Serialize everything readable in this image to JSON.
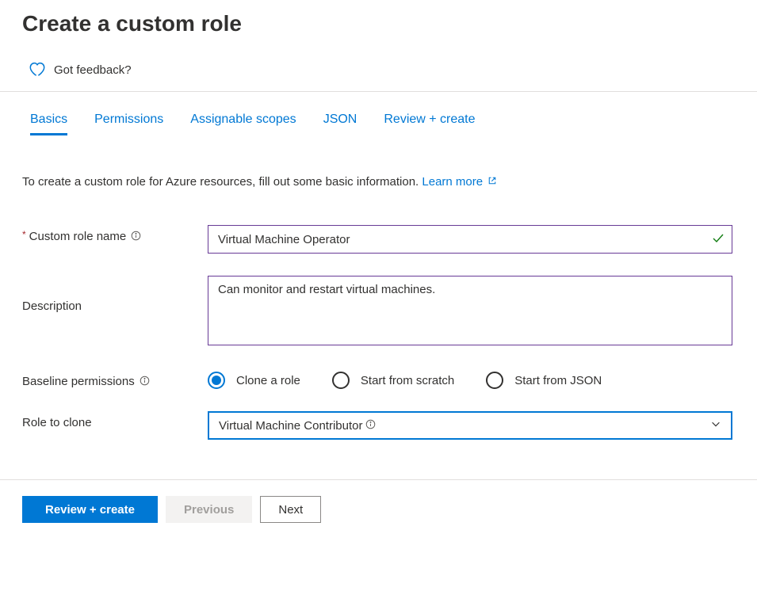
{
  "page_title": "Create a custom role",
  "feedback_label": "Got feedback?",
  "tabs": {
    "basics": "Basics",
    "permissions": "Permissions",
    "scopes": "Assignable scopes",
    "json": "JSON",
    "review": "Review + create"
  },
  "intro": {
    "text": "To create a custom role for Azure resources, fill out some basic information. ",
    "learn_more": "Learn more"
  },
  "form": {
    "name_label": "Custom role name",
    "name_value": "Virtual Machine Operator",
    "desc_label": "Description",
    "desc_value": "Can monitor and restart virtual machines.",
    "baseline_label": "Baseline permissions",
    "baseline_options": {
      "clone": "Clone a role",
      "scratch": "Start from scratch",
      "json": "Start from JSON"
    },
    "clone_label": "Role to clone",
    "clone_value": "Virtual Machine Contributor"
  },
  "footer": {
    "review": "Review + create",
    "previous": "Previous",
    "next": "Next"
  }
}
